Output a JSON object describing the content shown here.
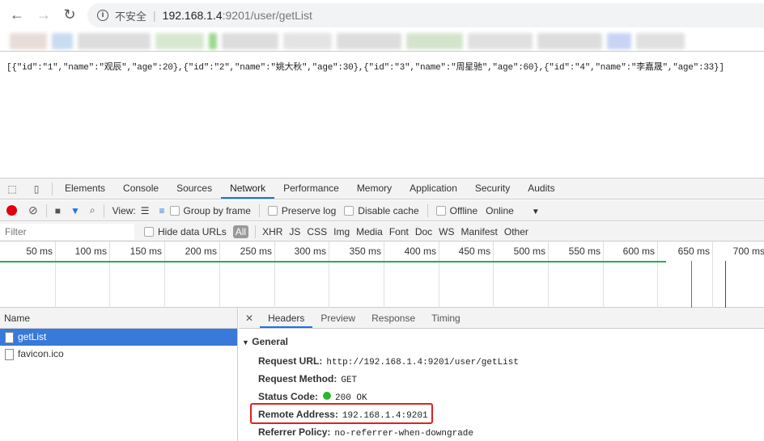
{
  "browser": {
    "security_label": "不安全",
    "url_host": "192.168.1.4",
    "url_rest": ":9201/user/getList"
  },
  "page": {
    "json_text": "[{\"id\":\"1\",\"name\":\"观辰\",\"age\":20},{\"id\":\"2\",\"name\":\"姚大秋\",\"age\":30},{\"id\":\"3\",\"name\":\"周星驰\",\"age\":60},{\"id\":\"4\",\"name\":\"李嘉晟\",\"age\":33}]"
  },
  "devtools": {
    "tabs": [
      "Elements",
      "Console",
      "Sources",
      "Network",
      "Performance",
      "Memory",
      "Application",
      "Security",
      "Audits"
    ],
    "toolbar": {
      "view_label": "View:",
      "group_by_frame": "Group by frame",
      "preserve_log": "Preserve log",
      "disable_cache": "Disable cache",
      "offline": "Offline",
      "throttle": "Online"
    },
    "filter": {
      "placeholder": "Filter",
      "hide_data_urls": "Hide data URLs",
      "types": [
        "All",
        "XHR",
        "JS",
        "CSS",
        "Img",
        "Media",
        "Font",
        "Doc",
        "WS",
        "Manifest",
        "Other"
      ]
    },
    "timeline": {
      "ticks": [
        "50 ms",
        "100 ms",
        "150 ms",
        "200 ms",
        "250 ms",
        "300 ms",
        "350 ms",
        "400 ms",
        "450 ms",
        "500 ms",
        "550 ms",
        "600 ms",
        "650 ms",
        "700 ms"
      ]
    },
    "requests": {
      "header": "Name",
      "items": [
        "getList",
        "favicon.ico"
      ]
    },
    "detail": {
      "tabs": [
        "Headers",
        "Preview",
        "Response",
        "Timing"
      ],
      "section": "General",
      "fields": [
        {
          "k": "Request URL:",
          "v": "http://192.168.1.4:9201/user/getList"
        },
        {
          "k": "Request Method:",
          "v": "GET"
        },
        {
          "k": "Status Code:",
          "v": "200 OK"
        },
        {
          "k": "Remote Address:",
          "v": "192.168.1.4:9201"
        },
        {
          "k": "Referrer Policy:",
          "v": "no-referrer-when-downgrade"
        }
      ]
    }
  },
  "colors": {
    "accent": "#1a73e8",
    "highlight_box": "#e02020",
    "status_ok": "#2db52d",
    "record": "#e0000f"
  }
}
